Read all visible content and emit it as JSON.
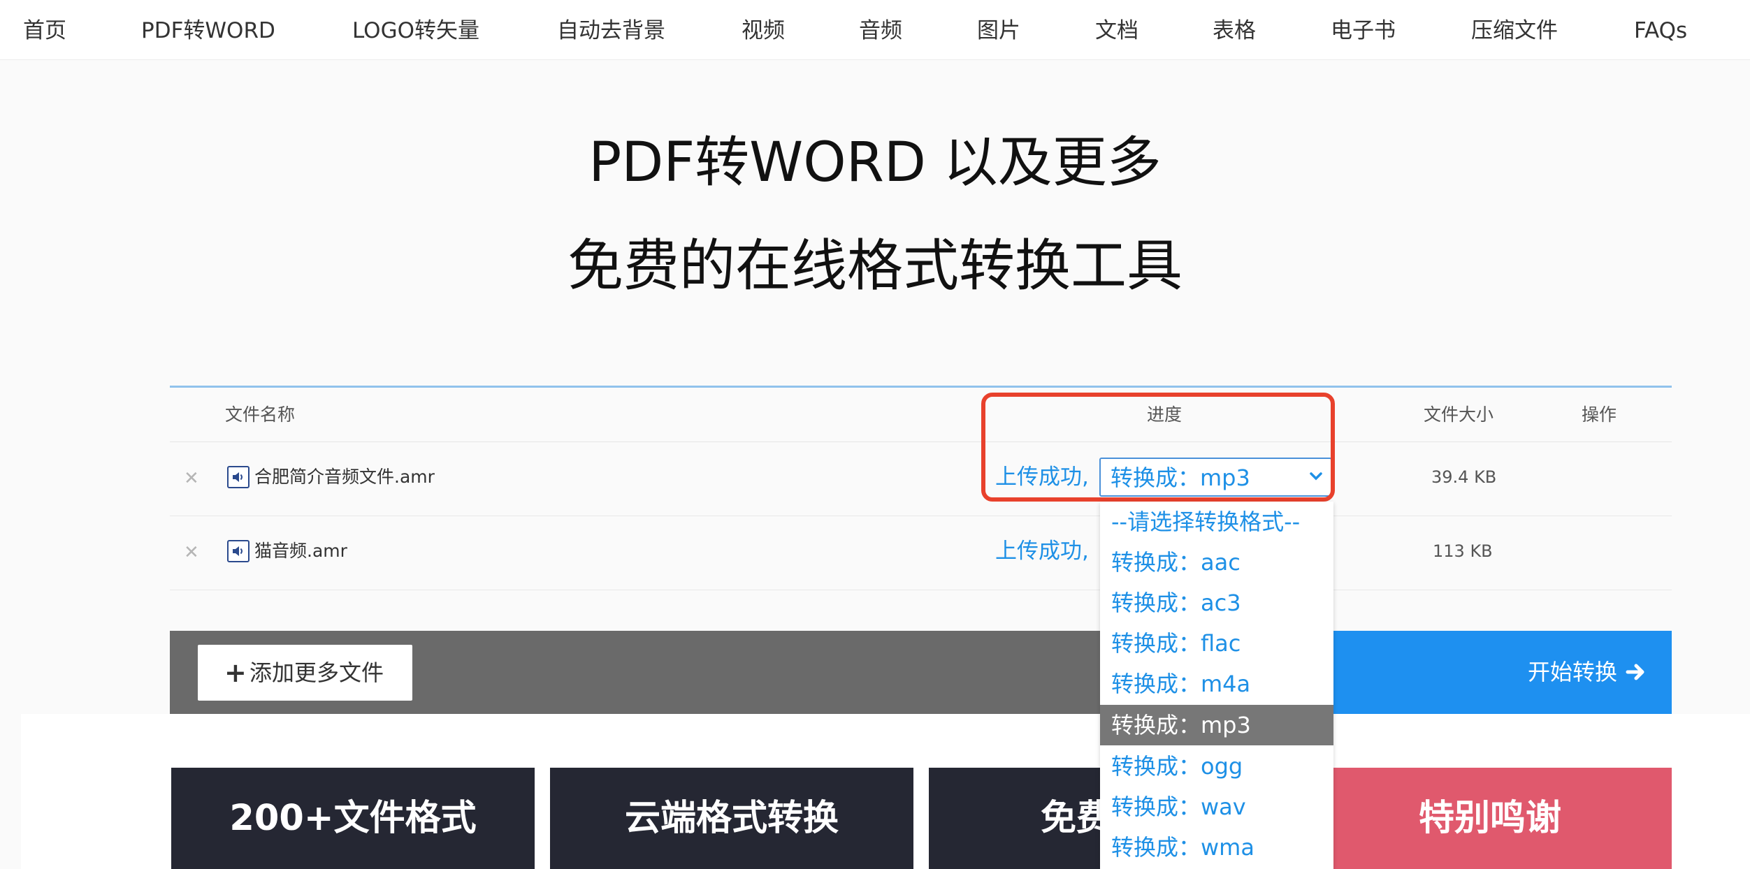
{
  "nav": {
    "items": [
      "首页",
      "PDF转WORD",
      "LOGO转矢量",
      "自动去背景",
      "视频",
      "音频",
      "图片",
      "文档",
      "表格",
      "电子书",
      "压缩文件",
      "FAQs"
    ]
  },
  "hero": {
    "line1": "PDF转WORD 以及更多",
    "line2": "免费的在线格式转换工具"
  },
  "table": {
    "headers": {
      "name": "文件名称",
      "progress": "进度",
      "size": "文件大小",
      "action": "操作"
    },
    "rows": [
      {
        "remove": "✕",
        "name": "合肥简介音频文件.amr",
        "status": "上传成功,",
        "selected": "转换成：mp3",
        "size": "39.4 KB"
      },
      {
        "remove": "✕",
        "name": "猫音频.amr",
        "status": "上传成功,",
        "size": "113 KB"
      }
    ]
  },
  "dropdown": {
    "options": [
      "--请选择转换格式--",
      "转换成：aac",
      "转换成：ac3",
      "转换成：flac",
      "转换成：m4a",
      "转换成：mp3",
      "转换成：ogg",
      "转换成：wav",
      "转换成：wma"
    ],
    "active_index": 5
  },
  "actions": {
    "add_plus": "+",
    "add_label": "添加更多文件",
    "start_label": "开始转换"
  },
  "features": {
    "cards": [
      "200+文件格式",
      "云端格式转换",
      "免费",
      "特别鸣谢"
    ]
  },
  "colors": {
    "accent_blue": "#1e90f0",
    "link_blue": "#1e90e6",
    "highlight_red": "#e8412c",
    "dark_card": "#252733",
    "pink_card": "#e0596d",
    "action_bar_gray": "#6a6a6a"
  },
  "icons": {
    "remove": "close-icon",
    "file": "audio-file-icon",
    "select": "chevron-down-icon",
    "start": "arrow-right-icon",
    "add": "plus-icon"
  }
}
